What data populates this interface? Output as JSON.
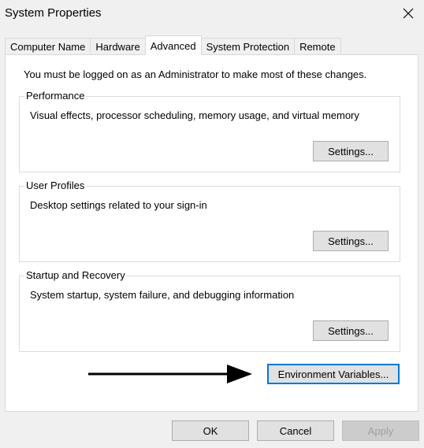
{
  "window": {
    "title": "System Properties"
  },
  "tabs": [
    {
      "label": "Computer Name",
      "active": false
    },
    {
      "label": "Hardware",
      "active": false
    },
    {
      "label": "Advanced",
      "active": true
    },
    {
      "label": "System Protection",
      "active": false
    },
    {
      "label": "Remote",
      "active": false
    }
  ],
  "advanced": {
    "admin_note": "You must be logged on as an Administrator to make most of these changes.",
    "groups": [
      {
        "label": "Performance",
        "description": "Visual effects, processor scheduling, memory usage, and virtual memory",
        "button": "Settings..."
      },
      {
        "label": "User Profiles",
        "description": "Desktop settings related to your sign-in",
        "button": "Settings..."
      },
      {
        "label": "Startup and Recovery",
        "description": "System startup, system failure, and debugging information",
        "button": "Settings..."
      }
    ],
    "env_button": "Environment Variables..."
  },
  "footer": {
    "ok": "OK",
    "cancel": "Cancel",
    "apply": "Apply"
  },
  "colors": {
    "accent": "#0078d7",
    "background": "#f0f0f0",
    "panel": "#ffffff",
    "arrow": "#000000"
  },
  "icons": {
    "close": "close-icon",
    "arrow": "arrow-right-icon"
  }
}
